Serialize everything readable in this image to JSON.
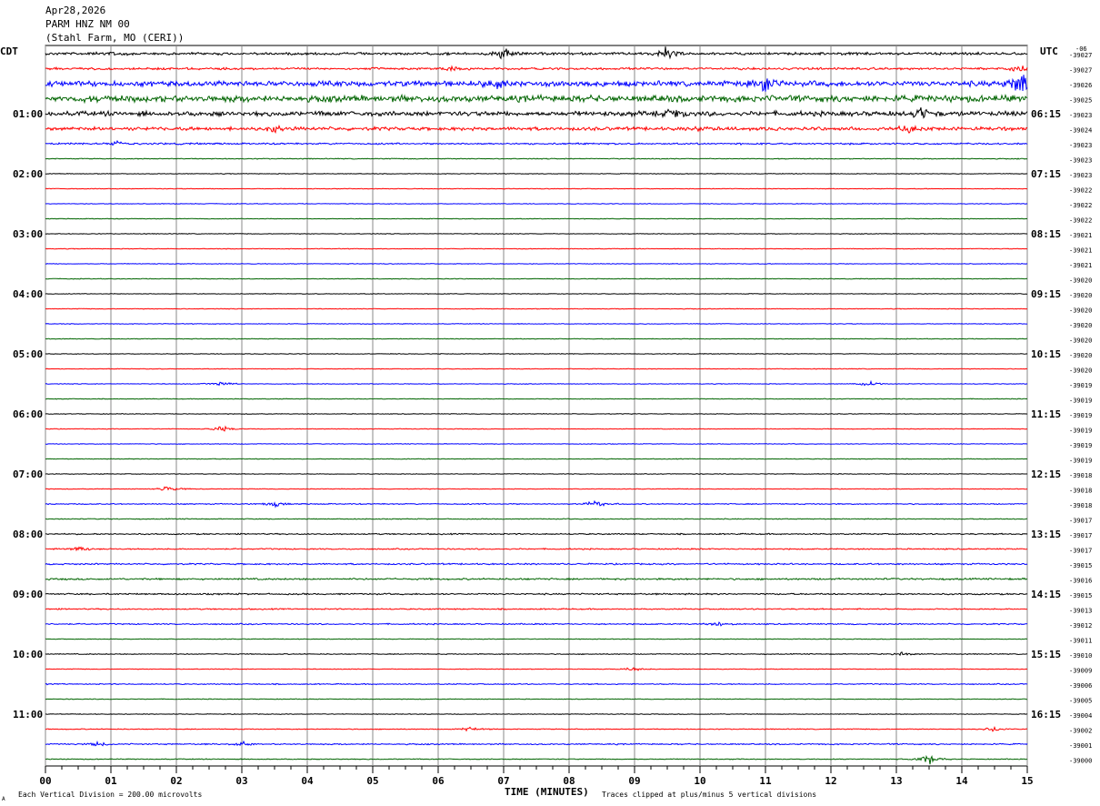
{
  "header": {
    "date": "Apr28,2026",
    "station": "PARM HNZ NM 00",
    "location": "(Stahl Farm, MO (CERI))"
  },
  "left_tz": "CDT",
  "right_tz": "UTC",
  "footer": {
    "scale_note": "Each Vertical Division =  200.00 microvolts",
    "clip_note": "Traces clipped at plus/minus 5 vertical divisions",
    "corner_mark": "A"
  },
  "colors": {
    "black": "#000000",
    "red": "#ff0000",
    "blue": "#0000ff",
    "green": "#006400",
    "grid": "#888888"
  },
  "chart_data": {
    "type": "line",
    "title": "PARM HNZ NM 00",
    "xlabel": "TIME (MINUTES)",
    "ylabel": "",
    "xlim": [
      0,
      15
    ],
    "x_ticks": [
      "00",
      "01",
      "02",
      "03",
      "04",
      "05",
      "06",
      "07",
      "08",
      "09",
      "10",
      "11",
      "12",
      "13",
      "14",
      "15"
    ],
    "left_hour_labels": [
      "01:00",
      "02:00",
      "03:00",
      "04:00",
      "05:00",
      "06:00",
      "07:00",
      "08:00",
      "09:00",
      "10:00",
      "11:00"
    ],
    "right_hour_labels": [
      "06:15",
      "07:15",
      "08:15",
      "09:15",
      "10:15",
      "11:15",
      "12:15",
      "13:15",
      "14:15",
      "15:15",
      "16:15"
    ],
    "trace_colors": [
      "black",
      "red",
      "blue",
      "green"
    ],
    "trace_offsets": [
      "-39027",
      "-39027",
      "-39026",
      "-39025",
      "-39023",
      "-39024",
      "-39023",
      "-39023",
      "-39023",
      "-39022",
      "-39022",
      "-39022",
      "-39021",
      "-39021",
      "-39021",
      "-39020",
      "-39020",
      "-39020",
      "-39020",
      "-39020",
      "-39020",
      "-39020",
      "-39019",
      "-39019",
      "-39019",
      "-39019",
      "-39019",
      "-39019",
      "-39018",
      "-39018",
      "-39018",
      "-39017",
      "-39017",
      "-39017",
      "-39015",
      "-39016",
      "-39015",
      "-39013",
      "-39012",
      "-39011",
      "-39010",
      "-39009",
      "-39006",
      "-39005",
      "-39004",
      "-39002",
      "-39001",
      "-39000"
    ],
    "trace_amplitude": [
      1.2,
      1.0,
      2.5,
      3.0,
      2.2,
      1.6,
      0.8,
      0.4,
      0.3,
      0.3,
      0.3,
      0.3,
      0.3,
      0.3,
      0.3,
      0.3,
      0.3,
      0.3,
      0.3,
      0.3,
      0.3,
      0.3,
      0.3,
      0.3,
      0.3,
      0.3,
      0.3,
      0.3,
      0.3,
      0.3,
      0.5,
      0.4,
      0.6,
      0.6,
      0.7,
      0.8,
      0.7,
      0.6,
      0.6,
      0.3,
      0.4,
      0.3,
      0.5,
      0.3,
      0.3,
      0.4,
      0.6,
      0.4
    ],
    "events": [
      {
        "trace": 0,
        "x": 7.0,
        "amp": 5
      },
      {
        "trace": 0,
        "x": 9.5,
        "amp": 6
      },
      {
        "trace": 0,
        "x": 1.0,
        "amp": 2
      },
      {
        "trace": 1,
        "x": 6.2,
        "amp": 2
      },
      {
        "trace": 1,
        "x": 14.9,
        "amp": 4
      },
      {
        "trace": 2,
        "x": 11.0,
        "amp": 8
      },
      {
        "trace": 2,
        "x": 14.9,
        "amp": 12
      },
      {
        "trace": 2,
        "x": 6.9,
        "amp": 4
      },
      {
        "trace": 4,
        "x": 9.6,
        "amp": 4
      },
      {
        "trace": 4,
        "x": 13.4,
        "amp": 5
      },
      {
        "trace": 5,
        "x": 3.5,
        "amp": 3
      },
      {
        "trace": 5,
        "x": 10.0,
        "amp": 2
      },
      {
        "trace": 5,
        "x": 13.2,
        "amp": 3
      },
      {
        "trace": 6,
        "x": 1.1,
        "amp": 2
      },
      {
        "trace": 22,
        "x": 12.6,
        "amp": 2
      },
      {
        "trace": 22,
        "x": 2.7,
        "amp": 3
      },
      {
        "trace": 25,
        "x": 2.7,
        "amp": 3
      },
      {
        "trace": 29,
        "x": 1.9,
        "amp": 3
      },
      {
        "trace": 30,
        "x": 3.5,
        "amp": 2
      },
      {
        "trace": 30,
        "x": 8.4,
        "amp": 3
      },
      {
        "trace": 33,
        "x": 0.55,
        "amp": 2
      },
      {
        "trace": 38,
        "x": 10.3,
        "amp": 2
      },
      {
        "trace": 40,
        "x": 13.1,
        "amp": 2
      },
      {
        "trace": 41,
        "x": 9.0,
        "amp": 2
      },
      {
        "trace": 45,
        "x": 6.5,
        "amp": 2
      },
      {
        "trace": 45,
        "x": 14.5,
        "amp": 2
      },
      {
        "trace": 46,
        "x": 0.8,
        "amp": 2
      },
      {
        "trace": 46,
        "x": 3.0,
        "amp": 2
      },
      {
        "trace": 47,
        "x": 13.5,
        "amp": 4
      }
    ]
  }
}
